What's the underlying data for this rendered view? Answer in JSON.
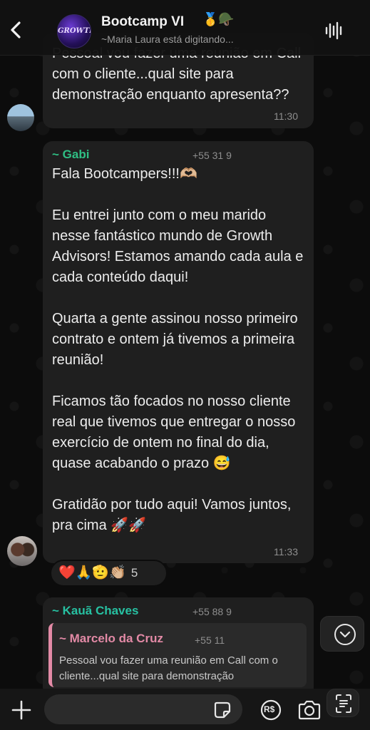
{
  "header": {
    "title": "Bootcamp VI",
    "title_emoji": "🥇🪖",
    "subtitle": "~Maria Laura está digitando...",
    "avatar_text": "GROWTH"
  },
  "messages": [
    {
      "text": "Pessoal vou fazer uma reunião em Call com o cliente...qual site para demonstração enquanto apresenta??",
      "time": "11:30"
    },
    {
      "sender": "~ Gabi",
      "phone": "+55 31 9",
      "text": "Fala Bootcampers!!!🫶🏼\n\nEu entrei junto com o meu marido nesse fantástico mundo de Growth Advisors! Estamos amando cada aula e cada conteúdo daqui!\n\nQuarta a gente assinou nosso primeiro contrato e ontem já tivemos a primeira reunião!\n\nFicamos tão focados no nosso cliente real que tivemos que entregar o nosso exercício de ontem no final do dia, quase acabando o prazo 😅\n\nGratidão por tudo aqui! Vamos juntos, pra cima 🚀🚀",
      "time": "11:33",
      "reactions": "❤️🙏🫡👏🏼",
      "reaction_count": "5"
    },
    {
      "sender": "~ Kauã Chaves",
      "phone": "+55 88 9",
      "quoted_sender": "~ Marcelo da Cruz",
      "quoted_phone": "+55 11",
      "quoted_text": "Pessoal vou fazer uma reunião em Call com o cliente...qual site para demonstração"
    }
  ],
  "composer": {
    "placeholder": "",
    "pay_label": "R$"
  },
  "colors": {
    "gabi_name": "#2fbf84",
    "kaua_name": "#27c1a2",
    "quoted_name": "#e38aa6",
    "bubble": "#1f1f1f"
  }
}
